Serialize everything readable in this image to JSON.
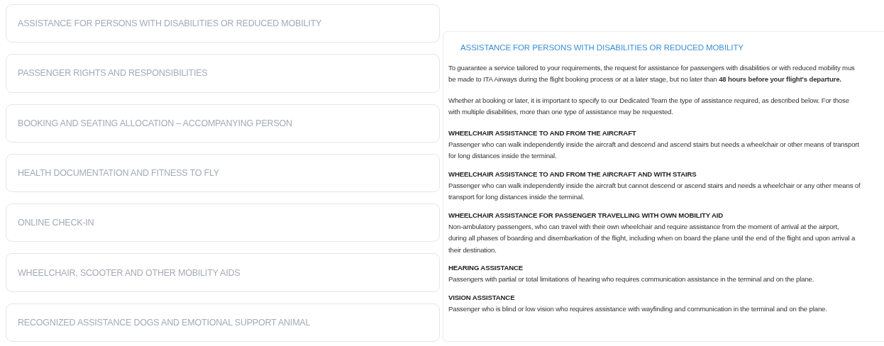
{
  "menu": [
    {
      "label": "ASSISTANCE FOR PERSONS WITH DISABILITIES OR REDUCED MOBILITY"
    },
    {
      "label": "PASSENGER RIGHTS AND RESPONSIBILITIES"
    },
    {
      "label": "BOOKING AND SEATING ALLOCATION – ACCOMPANYING PERSON"
    },
    {
      "label": "HEALTH DOCUMENTATION AND FITNESS TO FLY"
    },
    {
      "label": "ONLINE CHECK-IN"
    },
    {
      "label": "WHEELCHAIR, SCOOTER AND OTHER MOBILITY AIDS"
    },
    {
      "label": "RECOGNIZED ASSISTANCE DOGS AND EMOTIONAL SUPPORT ANIMAL"
    }
  ],
  "content": {
    "title": "ASSISTANCE FOR PERSONS WITH DISABILITIES OR REDUCED MOBILITY",
    "sections": [
      {
        "kind": "paragraph",
        "lines": [
          "To guarantee a service tailored to your requirements, the request for assistance for passengers with disabilities or with reduced mobility mus",
          "be made to ITA Airways during the flight booking process or at a later stage, but no later than **48 hours before your flight's departure.**"
        ]
      },
      {
        "kind": "paragraph",
        "lines": [
          "Whether at booking or later, it is important to specify to our Dedicated Team the type of assistance required, as described below. For those",
          "with multiple disabilities, more than one type of assistance may be requested."
        ]
      },
      {
        "kind": "item",
        "heading": "WHEELCHAIR ASSISTANCE TO AND FROM THE AIRCRAFT",
        "lines": [
          "Passenger who can walk independently inside the aircraft and descend and ascend stairs but needs a wheelchair or other means of transport",
          "for long distances inside the terminal."
        ]
      },
      {
        "kind": "item",
        "heading": "WHEELCHAIR ASSISTANCE TO AND FROM THE AIRCRAFT AND WITH STAIRS",
        "lines": [
          "Passenger who can walk independently inside the aircraft but cannot descend or ascend stairs and needs a wheelchair or any other means of",
          "transport for long distances inside the terminal."
        ]
      },
      {
        "kind": "item",
        "heading": "WHEELCHAIR ASSISTANCE FOR PASSENGER TRAVELLING WITH OWN MOBILITY AID",
        "lines": [
          "Non-ambulatory passengers, who can travel with their own wheelchair and require assistance from the moment of arrival at the airport,",
          "during all phases of boarding and disembarkation of the flight, including when on board the plane until the end of the flight and upon arrival a",
          "their destination."
        ]
      },
      {
        "kind": "item",
        "heading": "HEARING ASSISTANCE",
        "lines": [
          "Passengers with partial or total limitations of hearing who requires communication assistance in the terminal and on the plane."
        ]
      },
      {
        "kind": "item",
        "heading": "VISION ASSISTANCE",
        "lines": [
          "Passenger who is blind or low vision who requires assistance with wayfinding and communication in the terminal and on the plane."
        ]
      }
    ]
  }
}
